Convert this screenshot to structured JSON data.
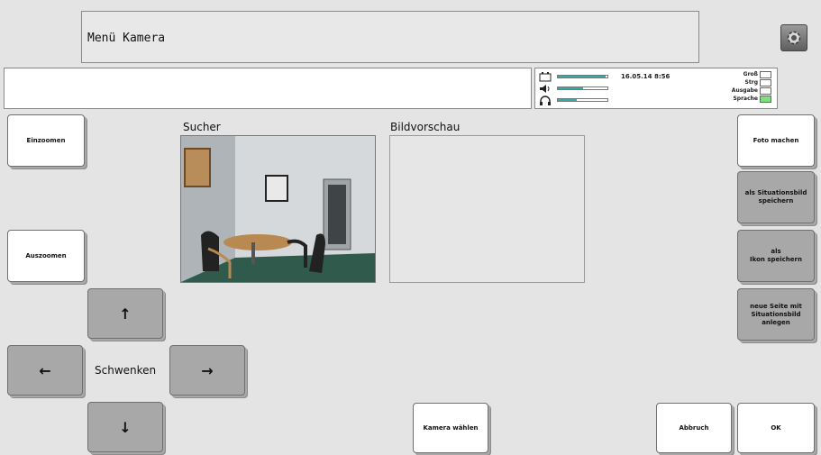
{
  "header": {
    "title": "Menü Kamera",
    "settings_icon": "gear-icon"
  },
  "input": {
    "value": ""
  },
  "status": {
    "datetime": "16.05.14 8:56",
    "meters": [
      {
        "icon": "battery-icon",
        "level": 0.97
      },
      {
        "icon": "speaker-icon",
        "level": 0.5
      },
      {
        "icon": "headphones-icon",
        "level": 0.38
      }
    ],
    "flags": [
      {
        "label": "Groß",
        "on": false
      },
      {
        "label": "Strg",
        "on": false
      },
      {
        "label": "Ausgabe",
        "on": false
      },
      {
        "label": "Sprache",
        "on": true
      }
    ],
    "active_color": "#7de07d",
    "meter_color": "#3aa6a6"
  },
  "viewer": {
    "label": "Sucher"
  },
  "preview": {
    "label": "Bildvorschau"
  },
  "zoom": {
    "zoom_in": "Einzoomen",
    "zoom_out": "Auszoomen"
  },
  "pan": {
    "label": "Schwenken",
    "up": "↑",
    "down": "↓",
    "left": "←",
    "right": "→"
  },
  "actions": {
    "take_photo": "Foto machen",
    "save_situation_1": "als Situationsbild",
    "save_situation_2": "speichern",
    "save_icon_1": "als",
    "save_icon_2": "Ikon speichern",
    "new_page_1": "neue Seite mit",
    "new_page_2": "Situationsbild",
    "new_page_3": "anlegen",
    "choose_camera": "Kamera wählen",
    "cancel": "Abbruch",
    "ok": "OK"
  },
  "colors": {
    "background": "#e4e4e4",
    "button_white": "#ffffff",
    "button_grey": "#a8a8a8"
  }
}
